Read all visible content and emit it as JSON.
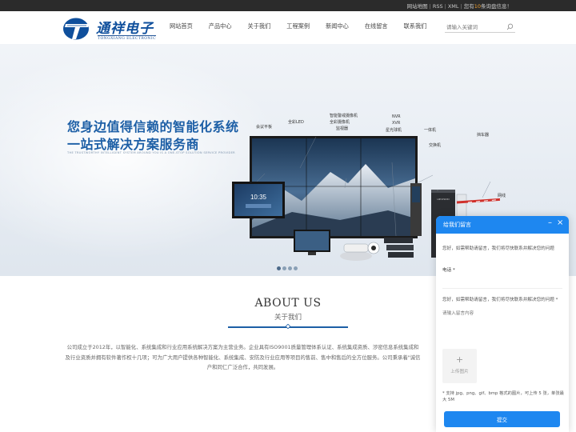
{
  "topbar": {
    "sitemap": "网站地图",
    "rss": "RSS",
    "xml": "XML",
    "notice_prefix": "您有",
    "notice_count": "10",
    "notice_suffix": "条询盘信息！"
  },
  "brand": {
    "name_cn": "通祥电子",
    "name_en": "TONGXIANG ELECTRONIC",
    "brand_color": "#0f4f9c"
  },
  "nav": {
    "items": [
      "网站首页",
      "产品中心",
      "关于我们",
      "工程案例",
      "新闻中心",
      "在线留言",
      "联系我们"
    ]
  },
  "search": {
    "placeholder": "请输入关键词",
    "icon": "search-icon"
  },
  "banner": {
    "title_line1": "您身边值得信赖的智能化系统",
    "title_line2": "一站式解决方案服务商",
    "subtitle": "THE TRUSTWORTHY INTELLIGENT SYSTEM AROUND YOU IS A ONE-STOP SOLUTION SERVICE PROVIDER",
    "screen_time": "10:35",
    "product_labels": [
      "会议平板",
      "全彩LED",
      "智能警戒摄像机",
      "全彩摄像机",
      "监视器",
      "NVR",
      "XVR",
      "星光球机",
      "一体机",
      "交换机",
      "挡车器",
      "网线"
    ],
    "slide_count": 4,
    "active_slide": 1,
    "accent_color": "#1d5fa6"
  },
  "about": {
    "title": "ABOUT US",
    "subtitle": "关于我们",
    "text_line1": "公司成立于2012年，以智能化、系统集成和行业应用系统解决方案为主营业务。企业具有ISO9001质量管理体系认证、系统集成资质、涉密信息系统集成和",
    "text_line2": "及行业资质并拥有软件著作权十几项；可为广大用户提供各种智能化、系统集成、安防及行业应用等项目的售前、售中和售后的全方位服务。公司秉承着\"诚信",
    "text_line3": "户和同仁广泛合作，共同发展。"
  },
  "chat": {
    "title": "给我们留言",
    "minimize_icon": "minus-icon",
    "close_icon": "close-icon",
    "intro": "您好，如需帮助请留言，我们将尽快联系并解决您的问题",
    "phone_label": "电话 *",
    "help_label": "您好，如需帮助请留言，我们将尽快联系并解决您的问题 *",
    "message_placeholder": "请输入留言内容",
    "upload_plus": "+",
    "upload_label": "上传图片",
    "upload_note": "* 支持 jpg、png、gif、bmp 格式的图片，可上传 5 张，单张最大 5M",
    "submit": "提交",
    "header_color": "#1e87f0"
  }
}
